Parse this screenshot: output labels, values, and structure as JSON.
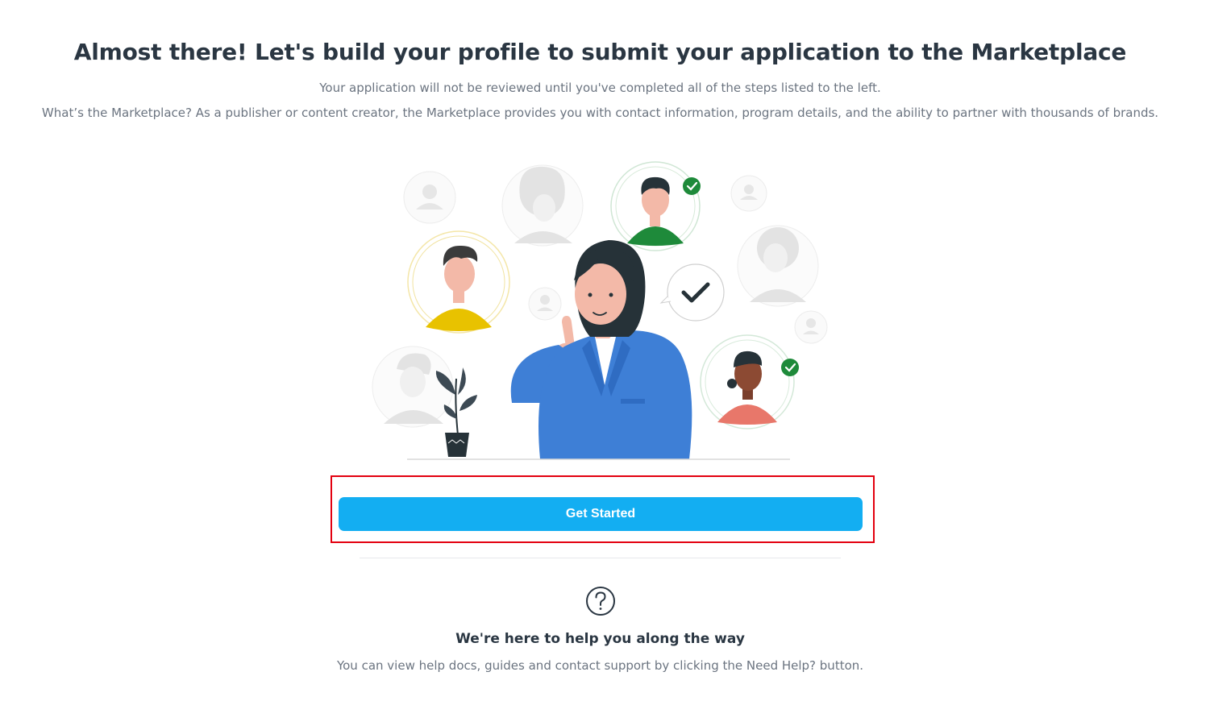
{
  "header": {
    "title": "Almost there! Let's build your profile to submit your application to the Marketplace",
    "subtitle": "Your application will not be reviewed until you've completed all of the steps listed to the left.",
    "description": "What’s the Marketplace? As a publisher or content creator, the Marketplace provides you with contact information, program details, and the ability to partner with thousands of brands."
  },
  "illustration": {
    "icon": "profile-network-illustration",
    "colors": {
      "jacket": "#3e7fd6",
      "hair": "#263238",
      "skin": "#f3b9a8",
      "yellow_shirt": "#e8c200",
      "green_shirt": "#1e8a3a",
      "pink_shirt": "#e8776a",
      "check_badge": "#1e8a3a",
      "faded_person": "#e3e3e3"
    }
  },
  "actions": {
    "get_started_label": "Get Started",
    "button_color": "#13aef2",
    "highlight_color": "#e3000f"
  },
  "help": {
    "icon": "question-circle-icon",
    "title": "We're here to help you along the way",
    "text": "You can view help docs, guides and contact support by clicking the Need Help? button."
  }
}
